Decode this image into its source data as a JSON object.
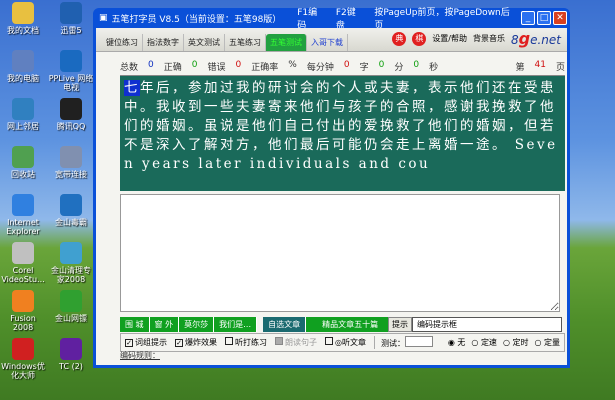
{
  "desktop": {
    "icons": [
      {
        "label": "我的文档",
        "color": "#e8c040"
      },
      {
        "label": "迅雷5",
        "color": "#2060b0"
      },
      {
        "label": "我的电脑",
        "color": "#6080c0"
      },
      {
        "label": "PPLive 网络电视",
        "color": "#1a6ac0"
      },
      {
        "label": "网上邻居",
        "color": "#3080c0"
      },
      {
        "label": "腾讯QQ",
        "color": "#202020"
      },
      {
        "label": "回收站",
        "color": "#50a050"
      },
      {
        "label": "宽带连接",
        "color": "#8090b0"
      },
      {
        "label": "Internet Explorer",
        "color": "#3080e0"
      },
      {
        "label": "金山毒霸",
        "color": "#2070c0"
      },
      {
        "label": "Corel VideoStu...",
        "color": "#c0c0c0"
      },
      {
        "label": "金山清理专家2008",
        "color": "#40a0d0"
      },
      {
        "label": "Fusion 2008",
        "color": "#f08020"
      },
      {
        "label": "金山网镖",
        "color": "#30a030"
      },
      {
        "label": "Windows优化大师",
        "color": "#d02020"
      },
      {
        "label": "TC (2)",
        "color": "#6020a0"
      }
    ]
  },
  "window": {
    "title": "五笔打字员 V8.5（当前设置：五笔98版）",
    "f1": "F1编码",
    "f2": "F2键盘",
    "pageup": "按PageUp前页，按PageDown后页",
    "tabs": [
      "键位练习",
      "指法数字",
      "英文测试",
      "五笔练习",
      "五笔测试",
      "入哥下载"
    ],
    "active_tab": 4,
    "badges": [
      "典",
      "棋"
    ],
    "settings": "设置/帮助",
    "music": "背景音乐",
    "logo_pre": "8",
    "logo_g": "g",
    "logo_post": "e.net"
  },
  "stats": {
    "total_label": "总数",
    "total": "0",
    "correct_label": "正确",
    "correct": "0",
    "wrong_label": "错误",
    "wrong": "0",
    "rate_label": "正确率",
    "rate_unit": "%",
    "speed_label": "每分钟",
    "speed": "0",
    "speed_unit": "字",
    "min": "0",
    "min_unit": "分",
    "sec": "0",
    "sec_unit": "秒",
    "page_pre": "第",
    "page": "41",
    "page_post": "页"
  },
  "passage": {
    "cursor_char": "七",
    "text": "年后，参加过我的研讨会的个人或夫妻，表示他们还在受患中。我收到一些夫妻寄来他们与孩子的合照，感谢我挽救了他们的婚姻。虽说是他们自己付出的爱挽救了他们的婚姻，但若不是深入了解对方，他们最后可能仍会走上离婚一途。 Seven years later individuals and cou"
  },
  "buttons": [
    "围 城",
    "窗 外",
    "莫尔莎",
    "我们是…"
  ],
  "buttons2": [
    "自选文章",
    "精品文章五十篇"
  ],
  "hint": {
    "label": "提示",
    "value": "编码提示框"
  },
  "options": {
    "checks": [
      {
        "label": "词组提示",
        "checked": true
      },
      {
        "label": "爆炸效果",
        "checked": true
      },
      {
        "label": "听打练习",
        "checked": false
      },
      {
        "label": "朗读句子",
        "checked": false,
        "disabled": true
      },
      {
        "label": "◎听文章",
        "checked": false
      }
    ],
    "test_label": "测试：",
    "radios": [
      {
        "label": "无",
        "selected": true
      },
      {
        "label": "定速",
        "selected": false
      },
      {
        "label": "定时",
        "selected": false
      },
      {
        "label": "定量",
        "selected": false
      }
    ]
  },
  "rule": "编码规则："
}
